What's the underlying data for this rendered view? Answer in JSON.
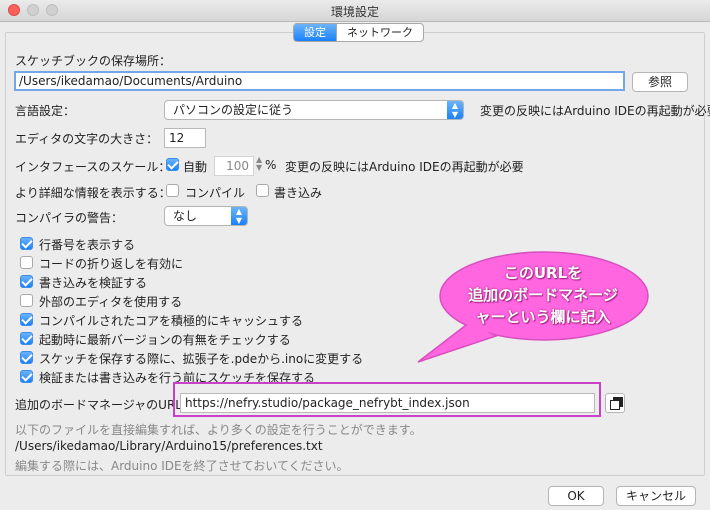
{
  "window": {
    "title": "環境設定"
  },
  "tabs": [
    {
      "label": "設定"
    },
    {
      "label": "ネットワーク"
    }
  ],
  "sketchbook": {
    "label": "スケッチブックの保存場所：",
    "path": "/Users/ikedamao/Documents/Arduino",
    "browse_label": "参照"
  },
  "language": {
    "label": "言語設定：",
    "value": "パソコンの設定に従う",
    "note": "変更の反映にはArduino IDEの再起動が必要"
  },
  "font_size": {
    "label": "エディタの文字の大きさ：",
    "value": "12"
  },
  "scale": {
    "label": "インタフェースのスケール：",
    "auto_label": "自動",
    "percent": "100",
    "percent_unit": "%",
    "note": "変更の反映にはArduino IDEの再起動が必要"
  },
  "verbose": {
    "label": "より詳細な情報を表示する：",
    "compile_label": "コンパイル",
    "upload_label": "書き込み"
  },
  "warnings": {
    "label": "コンパイラの警告：",
    "value": "なし"
  },
  "options": [
    {
      "label": "行番号を表示する",
      "checked": true
    },
    {
      "label": "コードの折り返しを有効に",
      "checked": false
    },
    {
      "label": "書き込みを検証する",
      "checked": true
    },
    {
      "label": "外部のエディタを使用する",
      "checked": false
    },
    {
      "label": "コンパイルされたコアを積極的にキャッシュする",
      "checked": true
    },
    {
      "label": "起動時に最新バージョンの有無をチェックする",
      "checked": true
    },
    {
      "label": "スケッチを保存する際に、拡張子を.pdeから.inoに変更する",
      "checked": true
    },
    {
      "label": "検証または書き込みを行う前にスケッチを保存する",
      "checked": true
    }
  ],
  "boards_url": {
    "label": "追加のボードマネージャのURL：",
    "value": "https://nefry.studio/package_nefrybt_index.json"
  },
  "prefs_note": "以下のファイルを直接編集すれば、より多くの設定を行うことができます。",
  "prefs_path": "/Users/ikedamao/Library/Arduino15/preferences.txt",
  "close_note": "編集する際には、Arduino IDEを終了させておいてください。",
  "callout": {
    "line1": "このURLを",
    "line2": "追加のボードマネージ",
    "line3": "ャーという欄に記入"
  },
  "buttons": {
    "ok": "OK",
    "cancel": "キャンセル"
  },
  "colors": {
    "accent": "#1a82fb",
    "callout": "#ff66e0",
    "highlight": "#c940c9"
  }
}
